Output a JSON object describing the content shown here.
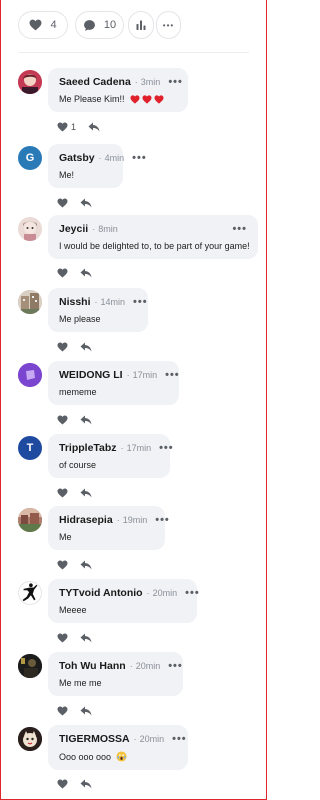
{
  "action_bar": {
    "like_count": "4",
    "comment_count": "10",
    "icons": [
      "heart-icon",
      "comment-bubble-icon",
      "stats-bars-icon",
      "more-icon"
    ]
  },
  "more_glyph": "•••",
  "dot": "·",
  "comments": [
    {
      "name": "Saeed Cadena",
      "time": "3min",
      "text": "Me Please Kim!!",
      "emoji": "hearts",
      "likes": "1",
      "avatar": "photo-red"
    },
    {
      "name": "Gatsby",
      "time": "4min",
      "text": "Me!",
      "likes": "",
      "avatar": "letter",
      "initial": "G",
      "color": "#2b7ab8"
    },
    {
      "name": "Jeycii",
      "time": "8min",
      "text": "I would be delighted to, to be part of your game!",
      "likes": "",
      "avatar": "photo-pink"
    },
    {
      "name": "Nisshi",
      "time": "14min",
      "text": "Me please",
      "likes": "",
      "avatar": "photo-building"
    },
    {
      "name": "WEIDONG LI",
      "time": "17min",
      "text": "mememe",
      "likes": "",
      "avatar": "shape-purple"
    },
    {
      "name": "TrippleTabz",
      "time": "17min",
      "text": "of course",
      "likes": "",
      "avatar": "letter",
      "initial": "T",
      "color": "#1e4aa0"
    },
    {
      "name": "Hidrasepia",
      "time": "19min",
      "text": "Me",
      "likes": "",
      "avatar": "photo-landscape"
    },
    {
      "name": "TYTvoid Antonio",
      "time": "20min",
      "text": "Meeee",
      "likes": "",
      "avatar": "logo-jumpman"
    },
    {
      "name": "Toh Wu Hann",
      "time": "20min",
      "text": "Me me me",
      "likes": "",
      "avatar": "photo-dark"
    },
    {
      "name": "TIGERMOSSA",
      "time": "20min",
      "text": "Ooo ooo ooo",
      "emoji": "screaming-face",
      "likes": "",
      "avatar": "photo-tiger"
    }
  ]
}
